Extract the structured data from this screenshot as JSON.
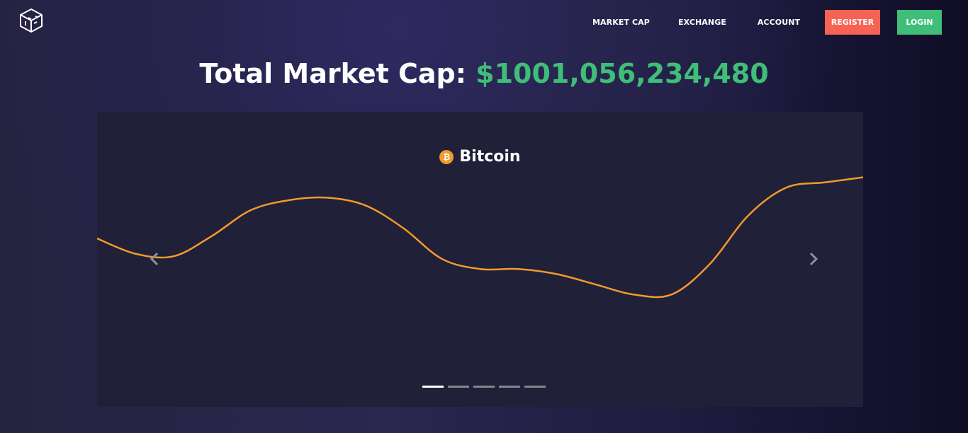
{
  "nav": {
    "links": [
      "MARKET CAP",
      "EXCHANGE",
      "ACCOUNT"
    ],
    "register_label": "REGISTER",
    "login_label": "LOGIN"
  },
  "header": {
    "title_prefix": "Total Market Cap:",
    "total_value": "$1001,056,234,480"
  },
  "carousel": {
    "slide": {
      "coin_name": "Bitcoin",
      "coin_icon": "bitcoin-icon",
      "coin_symbol": "₿",
      "line_color": "#f39a2b"
    },
    "indicator_count": 5,
    "active_index": 0
  },
  "colors": {
    "register": "#f56354",
    "login": "#3fbe78",
    "accent_green": "#3fbe78"
  },
  "chart_data": {
    "type": "line",
    "title": "",
    "xlabel": "",
    "ylabel": "",
    "x": [
      0,
      1,
      2,
      3,
      4,
      5,
      6,
      7,
      8,
      9,
      10,
      11,
      12,
      13,
      14,
      15,
      16,
      17,
      18,
      19,
      20
    ],
    "series": [
      {
        "values": [
          60,
          54,
          53,
          61,
          71,
          75,
          76,
          73,
          64,
          52,
          48,
          48,
          46,
          42,
          38,
          38,
          50,
          69,
          80,
          82,
          84
        ]
      }
    ],
    "ylim": [
      0,
      100
    ],
    "grid": false,
    "legend": "none"
  }
}
